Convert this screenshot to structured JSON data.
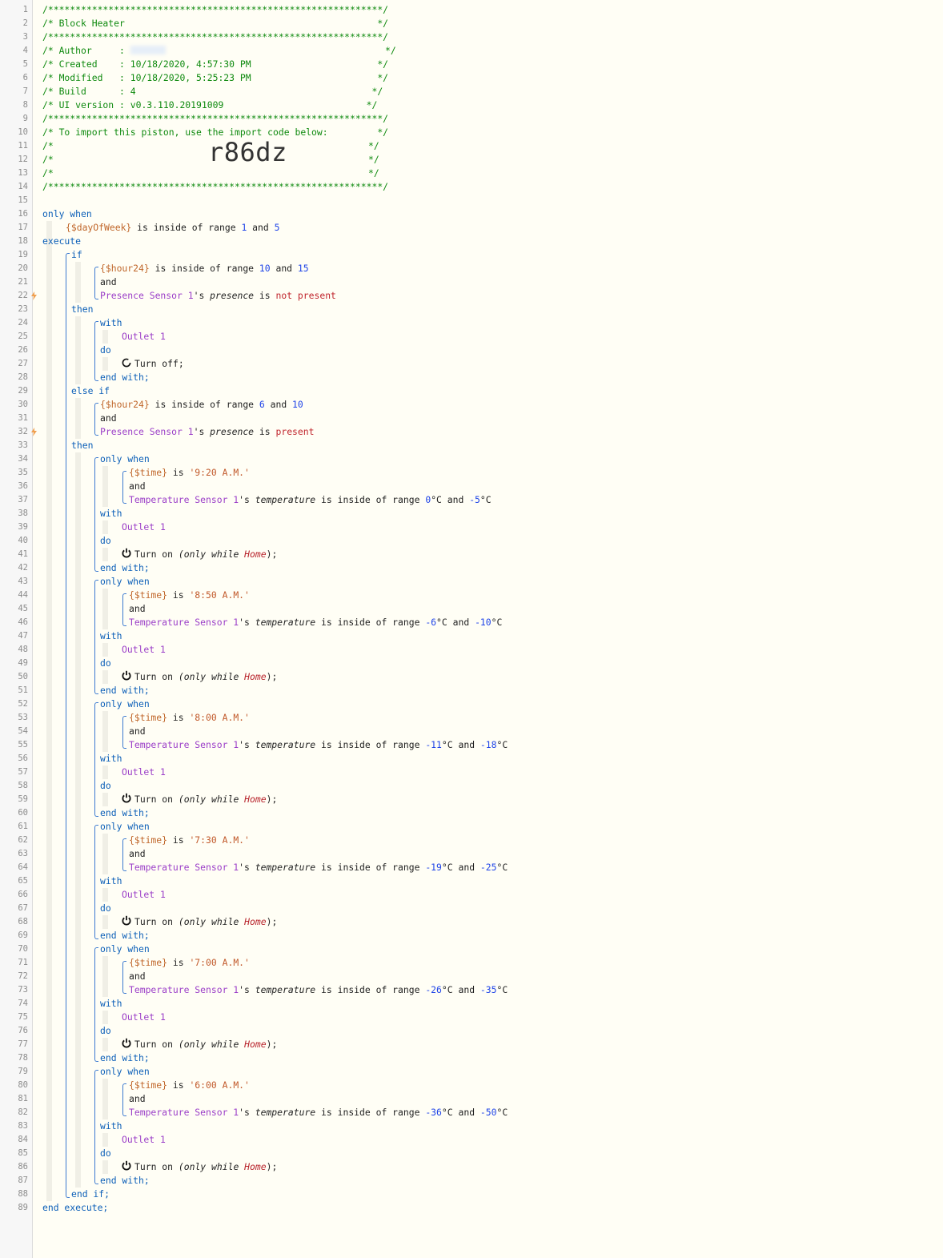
{
  "header": {
    "line1": "/*************************************************************/",
    "title": "/* Block Heater                                              */",
    "line3": "/*************************************************************/",
    "author_prefix": "/* Author     : ",
    "author_suffix": "                                        */",
    "created": "/* Created    : 10/18/2020, 4:57:30 PM                       */",
    "modified": "/* Modified   : 10/18/2020, 5:25:23 PM                       */",
    "build": "/* Build      : 4                                           */",
    "ui_version": "/* UI version : v0.3.110.20191009                          */",
    "line9": "/*************************************************************/",
    "import_note": "/* To import this piston, use the import code below:         */",
    "blank_open": "/*",
    "blank_close": "*/",
    "import_code": "r86dz",
    "line14": "/*************************************************************/"
  },
  "line_numbers": [
    "1",
    "2",
    "3",
    "4",
    "5",
    "6",
    "7",
    "8",
    "9",
    "10",
    "11",
    "12",
    "13",
    "14",
    "15",
    "16",
    "17",
    "18",
    "19",
    "20",
    "21",
    "22",
    "23",
    "24",
    "25",
    "26",
    "27",
    "28",
    "29",
    "30",
    "31",
    "32",
    "33",
    "34",
    "35",
    "36",
    "37",
    "38",
    "39",
    "40",
    "41",
    "42",
    "43",
    "44",
    "45",
    "46",
    "47",
    "48",
    "49",
    "50",
    "51",
    "52",
    "53",
    "54",
    "55",
    "56",
    "57",
    "58",
    "59",
    "60",
    "61",
    "62",
    "63",
    "64",
    "65",
    "66",
    "67",
    "68",
    "69",
    "70",
    "71",
    "72",
    "73",
    "74",
    "75",
    "76",
    "77",
    "78",
    "79",
    "80",
    "81",
    "82",
    "83",
    "84",
    "85",
    "86",
    "87",
    "88",
    "89"
  ],
  "keywords": {
    "only_when": "only when",
    "execute": "execute",
    "if": "if",
    "and": "and",
    "then": "then",
    "with": "with",
    "do": "do",
    "end_with": "end with;",
    "else_if": "else if",
    "end_if": "end if;",
    "end_execute": "end execute;"
  },
  "text": {
    "is_inside_range": " is inside of range ",
    "and_sep": " and ",
    "possessive": "'s ",
    "is": " is ",
    "is_space": " is ",
    "turn_off": "Turn off;",
    "turn_on": "Turn on ",
    "only_while_open": "(only while ",
    "only_while_close": ");",
    "deg_c": "°C"
  },
  "vars": {
    "dayofweek": "{$dayOfWeek}",
    "hour24": "{$hour24}",
    "time": "{$time}"
  },
  "devices": {
    "presence_sensor": "Presence Sensor 1",
    "outlet": "Outlet 1",
    "temp_sensor": "Temperature Sensor 1"
  },
  "attributes": {
    "presence": "presence",
    "temperature": "temperature"
  },
  "values": {
    "one": "1",
    "five": "5",
    "ten": "10",
    "fifteen": "15",
    "six": "6",
    "not_present": "not present",
    "present": "present",
    "home": "Home"
  },
  "rules": [
    {
      "time": "'9:20 A.M.'",
      "from": "0",
      "to": "-5"
    },
    {
      "time": "'8:50 A.M.'",
      "from": "-6",
      "to": "-10"
    },
    {
      "time": "'8:00 A.M.'",
      "from": "-11",
      "to": "-18"
    },
    {
      "time": "'7:30 A.M.'",
      "from": "-19",
      "to": "-25"
    },
    {
      "time": "'7:00 A.M.'",
      "from": "-26",
      "to": "-35"
    },
    {
      "time": "'6:00 A.M.'",
      "from": "-36",
      "to": "-50"
    }
  ],
  "colors": {
    "comment": "#0f8a0f",
    "keyword": "#0c5fb8",
    "variable": "#c0662a",
    "device": "#9b3ec8",
    "number": "#1f44e8",
    "warning": "#f0a050"
  },
  "icons": {
    "bolt": "lightning-bolt-icon",
    "power_off": "power-off-icon",
    "power_on": "power-on-icon"
  }
}
